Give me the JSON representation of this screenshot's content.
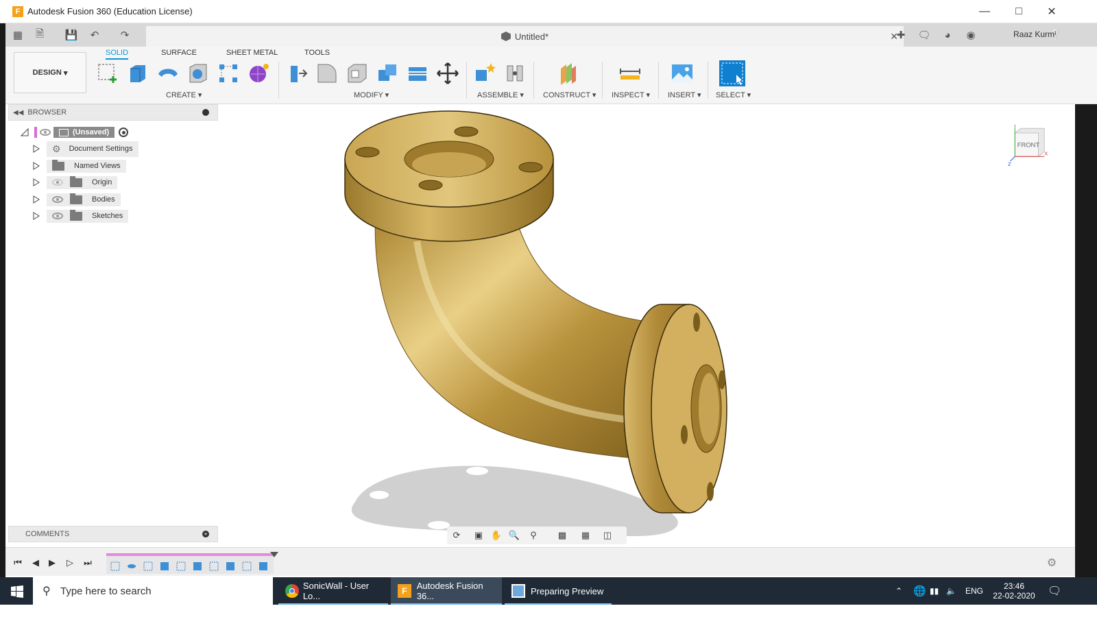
{
  "window": {
    "title": "Autodesk Fusion 360 (Education License)",
    "app_icon_letter": "F",
    "controls": [
      "minimize",
      "maximize",
      "close"
    ]
  },
  "quick_access": {
    "document_title": "Untitled*",
    "user_name": "Raaz Kurmi",
    "icons": [
      "grid-icon",
      "file-icon",
      "save-icon",
      "undo-icon",
      "redo-icon",
      "plus-icon",
      "chat-icon",
      "job-status-icon",
      "notification-icon",
      "help-icon"
    ]
  },
  "ribbon": {
    "workspace": "DESIGN",
    "tabs": [
      {
        "label": "SOLID",
        "active": true
      },
      {
        "label": "SURFACE",
        "active": false
      },
      {
        "label": "SHEET METAL",
        "active": false
      },
      {
        "label": "TOOLS",
        "active": false
      }
    ],
    "groups": {
      "create": "CREATE",
      "modify": "MODIFY",
      "assemble": "ASSEMBLE",
      "construct": "CONSTRUCT",
      "inspect": "INSPECT",
      "insert": "INSERT",
      "select": "SELECT"
    }
  },
  "browser": {
    "header": "BROWSER",
    "root": "(Unsaved)",
    "items": [
      {
        "label": "Document Settings",
        "icon": "gear-icon"
      },
      {
        "label": "Named Views",
        "icon": "folder-icon"
      },
      {
        "label": "Origin",
        "icon": "folder-icon"
      },
      {
        "label": "Bodies",
        "icon": "folder-icon"
      },
      {
        "label": "Sketches",
        "icon": "folder-icon"
      }
    ]
  },
  "viewcube": {
    "face": "FRONT",
    "axis_y": "Y",
    "axis_x": "X",
    "axis_z": "Z"
  },
  "comments": {
    "header": "COMMENTS"
  },
  "taskbar": {
    "search_placeholder": "Type here to search",
    "apps": [
      {
        "label": "SonicWall - User Lo...",
        "icon": "chrome-icon"
      },
      {
        "label": "Autodesk Fusion 36...",
        "icon": "fusion-icon"
      },
      {
        "label": "Preparing Preview",
        "icon": "preview-icon"
      }
    ],
    "language": "ENG",
    "time": "23:46",
    "date": "22-02-2020"
  },
  "colors": {
    "accent": "#0696d7",
    "timeline_marker": "#e08be0",
    "model_gold": "#c9a24a",
    "taskbar": "#1f2a36"
  }
}
